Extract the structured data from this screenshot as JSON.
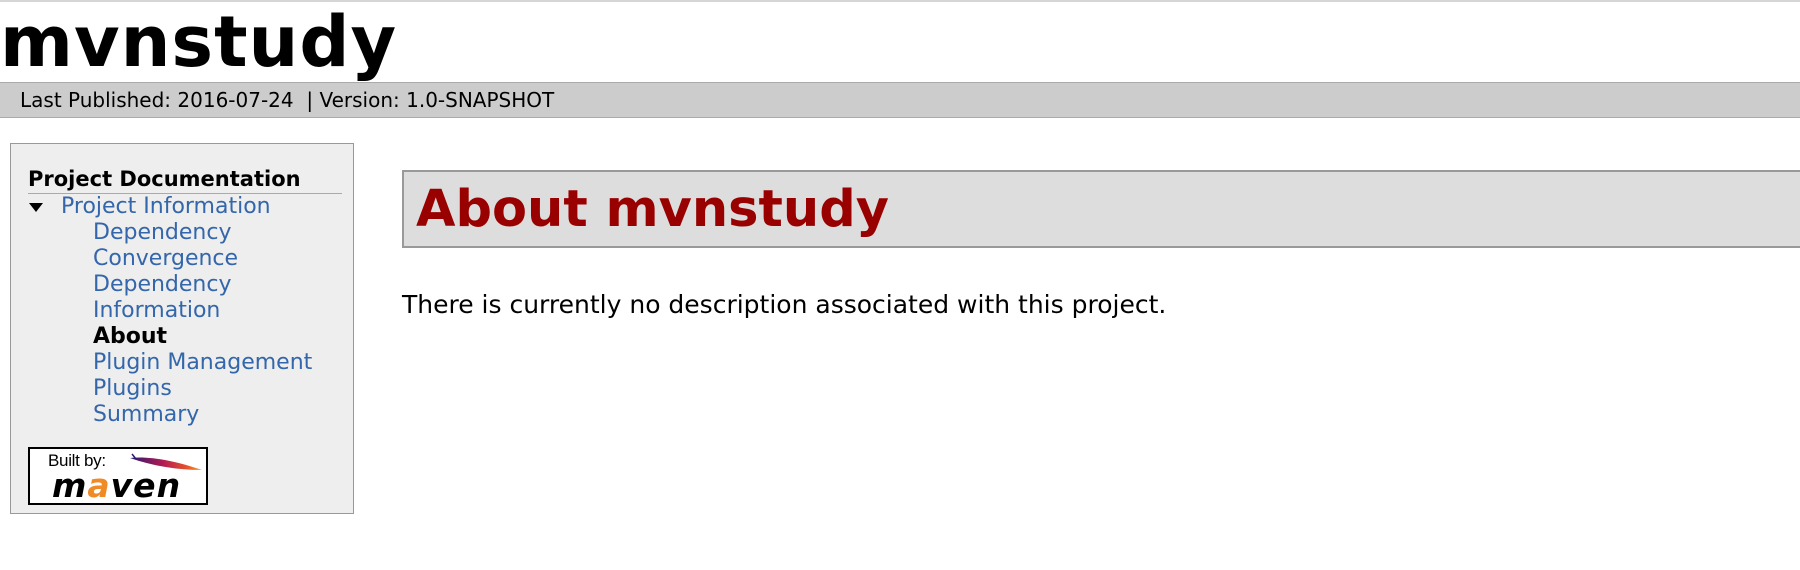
{
  "site": {
    "title": "mvnstudy",
    "published_label": "Last Published: 2016-07-24",
    "separator": "|",
    "version_label": "Version: 1.0-SNAPSHOT"
  },
  "sidebar": {
    "header": "Project Documentation",
    "section_icon": "caret-down-icon",
    "section_label": "Project Information",
    "items": [
      {
        "label": "Dependency",
        "active": false
      },
      {
        "label": "Convergence",
        "active": false
      },
      {
        "label": "Dependency",
        "active": false
      },
      {
        "label": "Information",
        "active": false
      },
      {
        "label": "About",
        "active": true
      },
      {
        "label": "Plugin Management",
        "active": false
      },
      {
        "label": "Plugins",
        "active": false
      },
      {
        "label": "Summary",
        "active": false
      }
    ],
    "badge": {
      "label": "Built by:",
      "brand": "maven",
      "icon": "feather-icon"
    }
  },
  "main": {
    "heading": "About mvnstudy",
    "description": "There is currently no description associated with this project."
  },
  "colors": {
    "heading": "#990000",
    "link": "#3366aa",
    "bar": "#cccccc",
    "sidebar_bg": "#eeeeee",
    "heading_box": "#dddddd"
  }
}
